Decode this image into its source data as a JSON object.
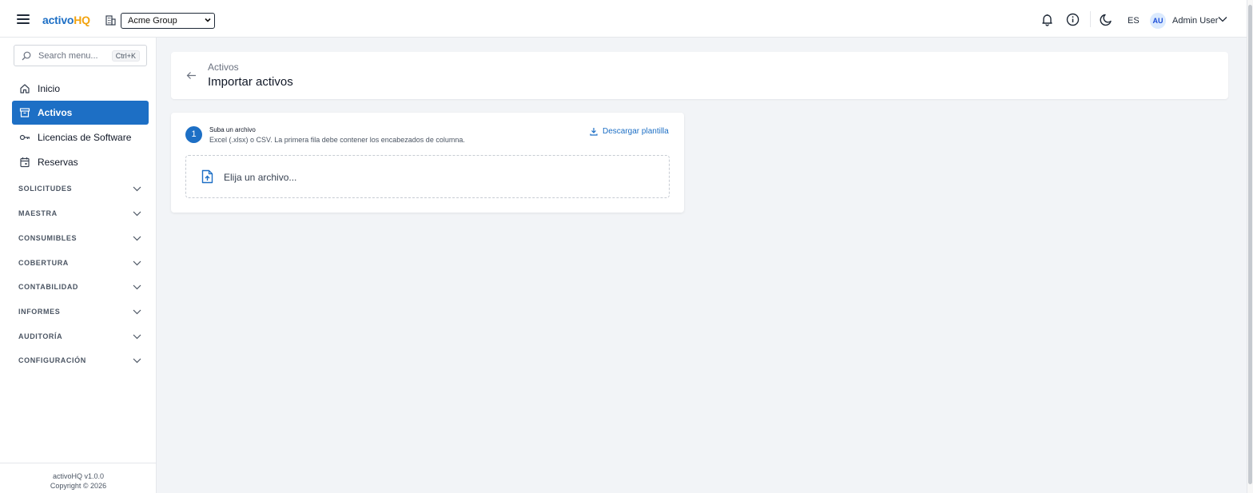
{
  "topbar": {
    "logo_part1": "activo",
    "logo_part2": "HQ",
    "org_selected": "Acme Group",
    "language": "ES",
    "avatar_initials": "AU",
    "user_name": "Admin User"
  },
  "sidebar": {
    "search_placeholder": "Search menu...",
    "search_shortcut": "Ctrl+K",
    "items": [
      {
        "label": "Inicio",
        "icon": "home-icon"
      },
      {
        "label": "Activos",
        "icon": "archive-icon",
        "active": true
      },
      {
        "label": "Licencias de Software",
        "icon": "key-icon"
      },
      {
        "label": "Reservas",
        "icon": "calendar-icon"
      }
    ],
    "groups": [
      {
        "label": "SOLICITUDES"
      },
      {
        "label": "MAESTRA"
      },
      {
        "label": "CONSUMIBLES"
      },
      {
        "label": "COBERTURA"
      },
      {
        "label": "CONTABILIDAD"
      },
      {
        "label": "INFORMES"
      },
      {
        "label": "AUDITORÍA"
      },
      {
        "label": "CONFIGURACIÓN"
      }
    ],
    "footer_version": "activoHQ v1.0.0",
    "footer_copyright": "Copyright © 2026"
  },
  "header": {
    "breadcrumb": "Activos",
    "title": "Importar activos"
  },
  "upload": {
    "step_number": "1",
    "step_title": "Suba un archivo",
    "step_description": "Excel (.xlsx) o CSV. La primera fila debe contener los encabezados de columna.",
    "download_label": "Descargar plantilla",
    "dropzone_label": "Elija un archivo..."
  },
  "colors": {
    "accent": "#1d6fc5",
    "logo_hq": "#f2a30f",
    "background": "#f2f4f7"
  }
}
